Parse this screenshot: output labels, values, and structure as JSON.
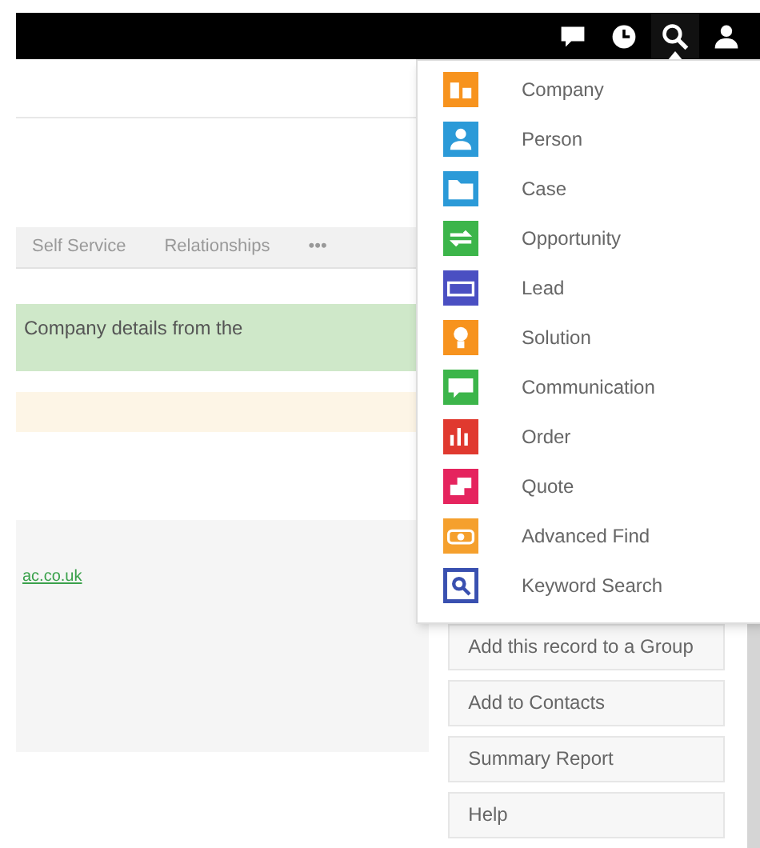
{
  "top_bar": {
    "icons": [
      {
        "kind": "chat",
        "selected": false
      },
      {
        "kind": "clock",
        "selected": false
      },
      {
        "kind": "search",
        "selected": true
      },
      {
        "kind": "user",
        "selected": false
      }
    ]
  },
  "tabs": [
    "Self Service",
    "Relationships",
    "•••"
  ],
  "notice": "Company details from the",
  "link": "ac.co.uk",
  "actions": [
    "Add this record to a Group",
    "Add to Contacts",
    "Summary Report",
    "Help"
  ],
  "new_menu": [
    {
      "label": "Company",
      "kind": "building",
      "color": "#f7931e"
    },
    {
      "label": "Person",
      "kind": "person",
      "color": "#2b9ad8"
    },
    {
      "label": "Case",
      "kind": "folder",
      "color": "#2b9ad8"
    },
    {
      "label": "Opportunity",
      "kind": "arrows",
      "color": "#3cb54a"
    },
    {
      "label": "Lead",
      "kind": "keyboard",
      "color": "#4a4fc2"
    },
    {
      "label": "Solution",
      "kind": "bulb",
      "color": "#f7931e"
    },
    {
      "label": "Communication",
      "kind": "chat",
      "color": "#3cb54a"
    },
    {
      "label": "Order",
      "kind": "chart",
      "color": "#e0392f"
    },
    {
      "label": "Quote",
      "kind": "papers",
      "color": "#e5245e"
    },
    {
      "label": "Advanced Find",
      "kind": "find",
      "color": "#f5a02d"
    },
    {
      "label": "Keyword Search",
      "kind": "search",
      "color": "#3950b0"
    }
  ]
}
